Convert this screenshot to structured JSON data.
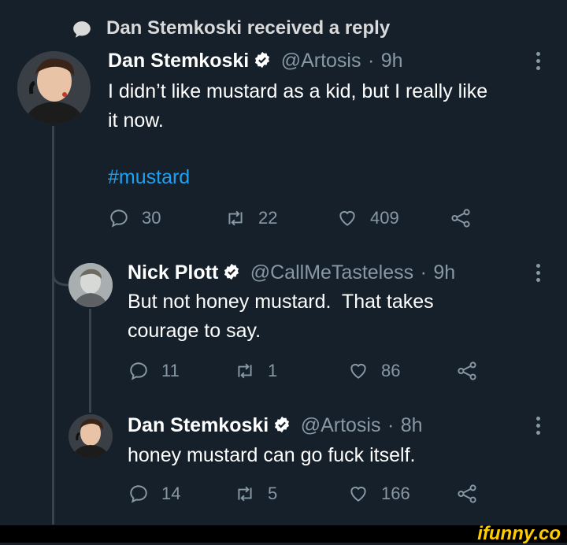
{
  "context": {
    "text": "Dan Stemkoski received a reply"
  },
  "tweets": [
    {
      "name": "Dan Stemkoski",
      "handle": "@Artosis",
      "time": "9h",
      "text_line1": "I didn’t like mustard as a kid, but I really like",
      "text_line2": "it now.",
      "hashtag": "#mustard",
      "replies": "30",
      "retweets": "22",
      "likes": "409"
    },
    {
      "name": "Nick Plott",
      "handle": "@CallMeTasteless",
      "time": "9h",
      "text_line1": "But not honey mustard.  That takes",
      "text_line2": "courage to say.",
      "replies": "11",
      "retweets": "1",
      "likes": "86"
    },
    {
      "name": "Dan Stemkoski",
      "handle": "@Artosis",
      "time": "8h",
      "text_line1": "honey mustard can go fuck itself.",
      "replies": "14",
      "retweets": "5",
      "likes": "166"
    }
  ],
  "separator": "·",
  "watermark": "ifunny.co",
  "colors": {
    "background": "#15202b",
    "secondary": "#8899a6",
    "accent": "#1da1f2"
  }
}
